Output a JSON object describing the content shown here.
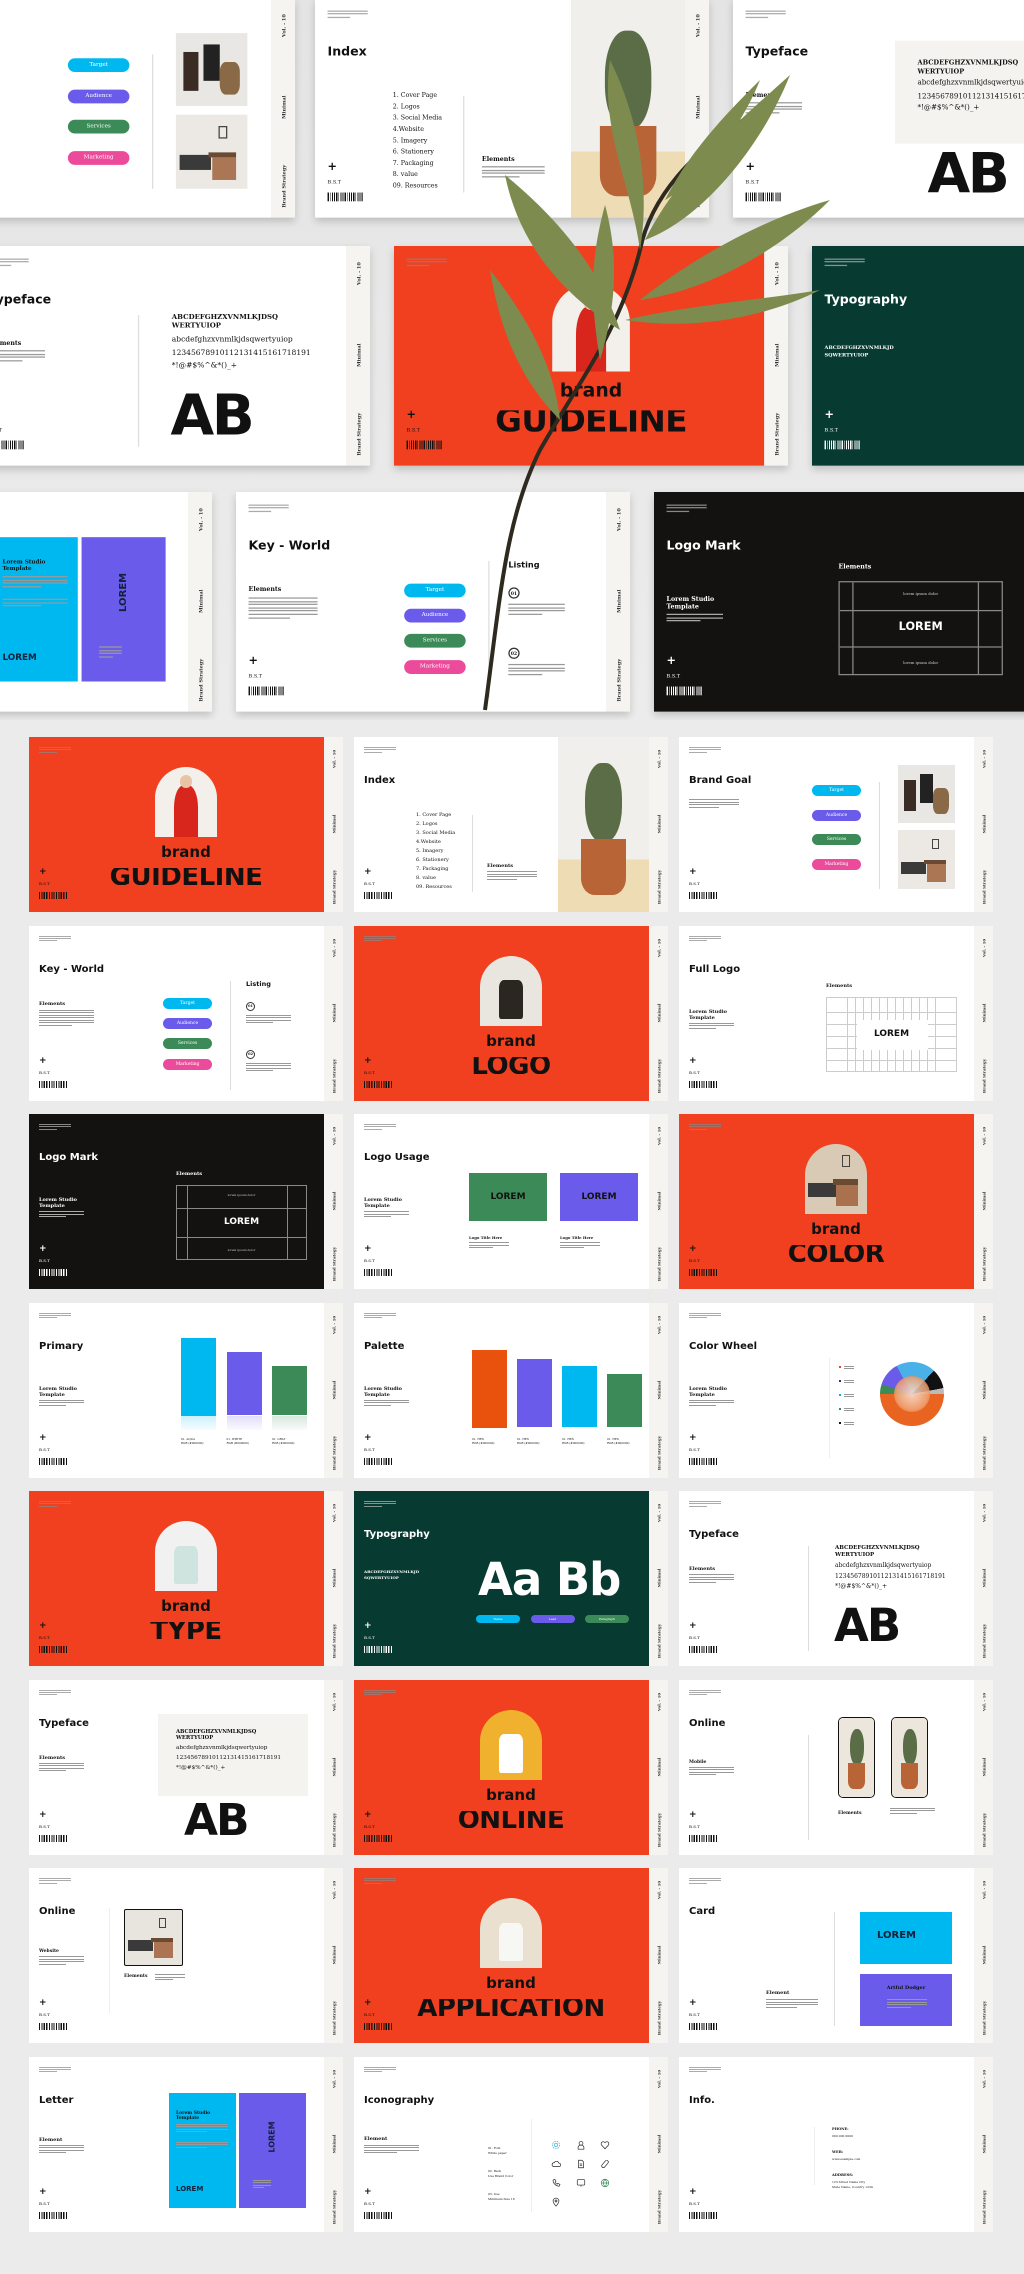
{
  "common": {
    "vol": "Vol. - 10",
    "minimal": "Minimal",
    "strategy": "Brand Strategy",
    "bst": "B.S.T",
    "plus": "+"
  },
  "colors": {
    "red": "#f0401f",
    "dark_green": "#073a31",
    "black": "#141211",
    "cyan": "#00b8f0",
    "purple": "#6b5bea",
    "green": "#3c8a57",
    "pink": "#ec4a9a",
    "orange": "#e8520c",
    "background": "#e9e9e9"
  },
  "pills": [
    {
      "label": "Target",
      "color": "#00b8f0"
    },
    {
      "label": "Audience",
      "color": "#6b5bea"
    },
    {
      "label": "Services",
      "color": "#3c8a57"
    },
    {
      "label": "Marketing",
      "color": "#ec4a9a"
    }
  ],
  "font_sample": {
    "upper1": "ABCDEFGHZXVNMLKJDSQ",
    "upper2": "WERTYUIOP",
    "lower": "abcdefghzxvnmlkjdsqwertyuiop",
    "digits": "12345678910112131415161718191",
    "symbols": "*!@#$%^&*()_+",
    "big": "AB"
  },
  "labels": {
    "elements": "Elements",
    "element": "Element",
    "lorem_studio_1": "Lorem Studio",
    "lorem_studio_2": "Template",
    "lorem": "LOREM",
    "lorem_ipsum": "lorem ipsum dolor",
    "listing": "Listing",
    "logo_title": "Logo Title Here",
    "mobile": "Mobile",
    "website": "Website",
    "brand": "brand"
  },
  "index_items": [
    "1. Cover Page",
    "2. Logos",
    "3. Social Media",
    "4.Website",
    "5. Imagery",
    "6. Stationery",
    "7. Packaging",
    "8. value",
    "09. Resources"
  ],
  "typography": {
    "upper1": "ABCDEFGHZXVNMLKJD",
    "upper2": "SQWERTYUIOP",
    "big": "Aa Bb",
    "big_hero": "Aa",
    "tags": [
      {
        "label": "Name",
        "color": "#00b8f0"
      },
      {
        "label": "Lead",
        "color": "#6b5bea"
      },
      {
        "label": "Paragraph",
        "color": "#3c8a57"
      }
    ]
  },
  "primary_swatches": [
    {
      "color": "#00b8f0",
      "name": "01. AQUA",
      "code": "RGB (#000000)",
      "level": 1.0
    },
    {
      "color": "#6b5bea",
      "name": "01. WHITE",
      "code": "RGB (#000000)",
      "level": 0.81
    },
    {
      "color": "#3c8a57",
      "name": "01. GRAY",
      "code": "RGB (#000000)",
      "level": 0.64
    }
  ],
  "palette_swatches": [
    {
      "color": "#e8520c",
      "name": "01. HEX",
      "code": "RGB (#000000)",
      "level": 1.0
    },
    {
      "color": "#6b5bea",
      "name": "01. HEX",
      "code": "RGB (#000000)",
      "level": 0.88
    },
    {
      "color": "#00b8f0",
      "name": "01. HEX",
      "code": "RGB (#000000)",
      "level": 0.79
    },
    {
      "color": "#3c8a57",
      "name": "01. HEX",
      "code": "RGB (#000000)",
      "level": 0.68
    }
  ],
  "wheel_legend": [
    "#e8402a",
    "#2a2f6e",
    "#00b8f0",
    "#3c8a57",
    "#111111"
  ],
  "card": {
    "name": "Artful Dodger"
  },
  "iconography": {
    "items": [
      {
        "a": "01. Font",
        "b": "White paper"
      },
      {
        "a": "02. Back",
        "b": "Use Brand Color"
      },
      {
        "a": "03. Use",
        "b": "Minimum Size 18"
      }
    ],
    "icons": [
      "gear-icon",
      "user-icon",
      "heart-icon",
      "cloud-icon",
      "document-icon",
      "tag-icon",
      "phone-icon",
      "monitor-icon",
      "globe-icon",
      "map-pin-icon"
    ]
  },
  "info": {
    "phone_label": "PHONE:",
    "phone": "000 000 0000",
    "web_label": "WEB:",
    "web": "www.example.com",
    "address_label": "ADDRESS:",
    "address1": "123 Street Name City",
    "address2": "State Name, Country 1234"
  },
  "hero_slides": [
    {
      "type": "goal",
      "theme": "white"
    },
    {
      "type": "index",
      "theme": "white",
      "title": "Index"
    },
    {
      "type": "typeface_box",
      "theme": "white",
      "title": "Typeface"
    },
    {
      "type": "typeface",
      "theme": "white",
      "title": "Typeface"
    },
    {
      "type": "cover",
      "theme": "red",
      "word": "GUIDELINE",
      "photo": {
        "name": "woman-in-red-photo",
        "bg": "#f3f0eb",
        "accent": "#d8261c"
      }
    },
    {
      "type": "typography_hero",
      "theme": "dark",
      "title": "Typography"
    },
    {
      "type": "letter",
      "theme": "white"
    },
    {
      "type": "keyworld",
      "theme": "white",
      "title": "Key - World"
    },
    {
      "type": "logomark",
      "theme": "black",
      "title": "Logo Mark"
    }
  ],
  "grid_slides": [
    {
      "type": "cover",
      "theme": "red",
      "word": "GUIDELINE",
      "photo": {
        "name": "woman-in-red-photo",
        "bg": "#f3f0eb",
        "accent": "#d8261c"
      }
    },
    {
      "type": "index",
      "theme": "white",
      "title": "Index"
    },
    {
      "type": "goal",
      "theme": "white",
      "title": "Brand Goal"
    },
    {
      "type": "keyworld",
      "theme": "white",
      "title": "Key - World"
    },
    {
      "type": "cover",
      "theme": "red",
      "word": "LOGO",
      "photo": {
        "name": "vase-photo",
        "bg": "#e9e5df",
        "accent": "#2b2622"
      }
    },
    {
      "type": "fulllogo",
      "theme": "white",
      "title": "Full Logo"
    },
    {
      "type": "logomark",
      "theme": "black",
      "title": "Logo Mark"
    },
    {
      "type": "logousage",
      "theme": "white",
      "title": "Logo Usage"
    },
    {
      "type": "cover",
      "theme": "red",
      "word": "COLOR",
      "photo": {
        "name": "living-room-photo",
        "bg": "#d9cab5",
        "accent": "#4e7a3a"
      }
    },
    {
      "type": "primary",
      "theme": "white",
      "title": "Primary"
    },
    {
      "type": "palette",
      "theme": "white",
      "title": "Palette"
    },
    {
      "type": "wheel",
      "theme": "white",
      "title": "Color Wheel"
    },
    {
      "type": "cover",
      "theme": "red",
      "word": "TYPE",
      "photo": {
        "name": "cup-in-hand-photo",
        "bg": "#f1f1f1",
        "accent": "#cfe3df"
      }
    },
    {
      "type": "typography",
      "theme": "dark",
      "title": "Typography"
    },
    {
      "type": "typeface",
      "theme": "white",
      "title": "Typeface"
    },
    {
      "type": "typeface_box",
      "theme": "white",
      "title": "Typeface"
    },
    {
      "type": "cover",
      "theme": "red",
      "word": "ONLINE",
      "photo": {
        "name": "mug-photo",
        "bg": "#f0b22e",
        "accent": "#ffffff"
      }
    },
    {
      "type": "mobile",
      "theme": "white",
      "title": "Online"
    },
    {
      "type": "website",
      "theme": "white",
      "title": "Online"
    },
    {
      "type": "cover",
      "theme": "red",
      "word": "APPLICATION",
      "photo": {
        "name": "bottle-photo",
        "bg": "#e9e0cf",
        "accent": "#f7f7f4"
      }
    },
    {
      "type": "card",
      "theme": "white",
      "title": "Card"
    },
    {
      "type": "letter",
      "theme": "white",
      "title": "Letter"
    },
    {
      "type": "iconography",
      "theme": "white",
      "title": "Iconography"
    },
    {
      "type": "info",
      "theme": "white",
      "title": "Info."
    }
  ]
}
